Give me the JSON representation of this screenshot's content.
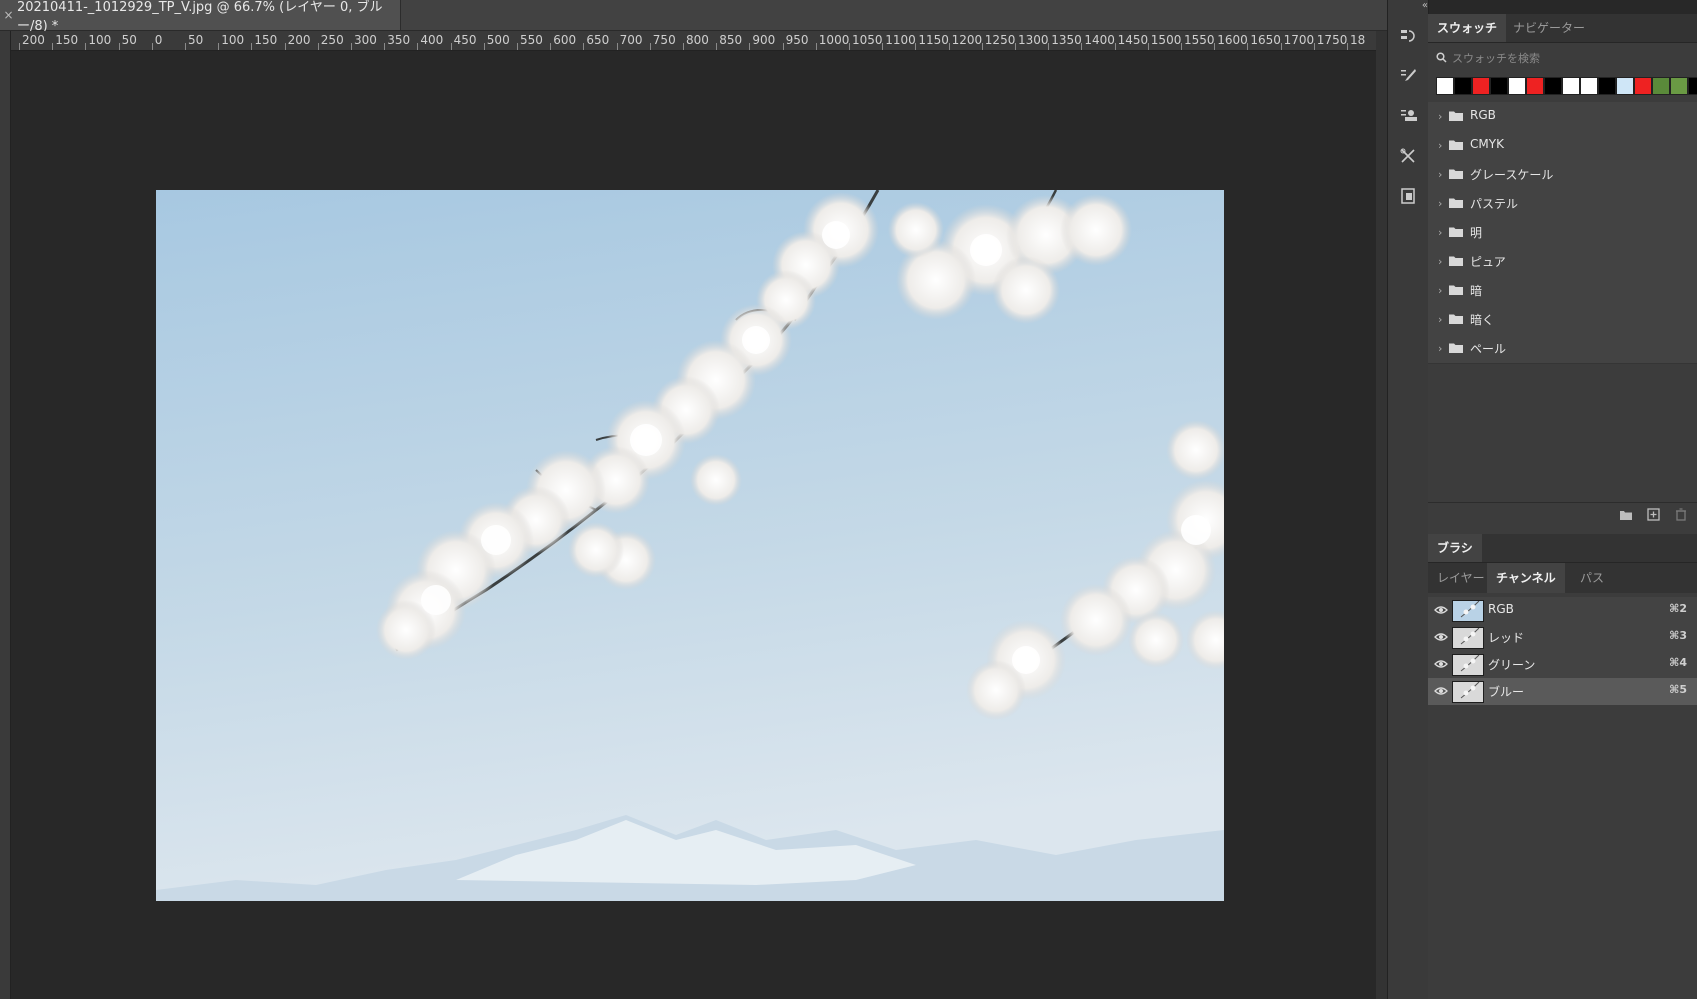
{
  "document": {
    "tab_title": "20210411-_1012929_TP_V.jpg @ 66.7% (レイヤー 0, ブルー/8) *",
    "close_glyph": "×"
  },
  "ruler": {
    "labels": [
      "200",
      "150",
      "100",
      "50",
      "0",
      "50",
      "100",
      "150",
      "200",
      "250",
      "300",
      "350",
      "400",
      "450",
      "500",
      "550",
      "600",
      "650",
      "700",
      "750",
      "800",
      "850",
      "900",
      "950",
      "1000",
      "1050",
      "1100",
      "1150",
      "1200",
      "1250",
      "1300",
      "1350",
      "1400",
      "1450",
      "1500",
      "1550",
      "1600",
      "1650",
      "1700",
      "1750",
      "18"
    ]
  },
  "toolstrip": {
    "collapse_glyph": "«",
    "icons": [
      "history-icon",
      "brush-settings-icon",
      "clone-source-icon",
      "tool-presets-icon",
      "properties-icon"
    ]
  },
  "swatches_panel": {
    "tabs": [
      {
        "label": "スウォッチ",
        "active": true
      },
      {
        "label": "ナビゲーター",
        "active": false
      }
    ],
    "search_placeholder": "スウォッチを検索",
    "recent_colors": [
      "#ffffff",
      "#000000",
      "#ee2222",
      "#000000",
      "#ffffff",
      "#ee2222",
      "#000000",
      "#ffffff",
      "#ffffff",
      "#000000",
      "#cfe6f7",
      "#ee2222",
      "#5a8a3a",
      "#6a9a44",
      "#000000"
    ],
    "groups": [
      "RGB",
      "CMYK",
      "グレースケール",
      "パステル",
      "明",
      "ピュア",
      "暗",
      "暗く",
      "ペール"
    ]
  },
  "brush_panel": {
    "label": "ブラシ"
  },
  "channels_panel": {
    "tabs": [
      {
        "label": "レイヤー",
        "active": false
      },
      {
        "label": "チャンネル",
        "active": true
      },
      {
        "label": "パス",
        "active": false
      }
    ],
    "channels": [
      {
        "name": "RGB",
        "shortcut": "⌘2",
        "selected": false
      },
      {
        "name": "レッド",
        "shortcut": "⌘3",
        "selected": false
      },
      {
        "name": "グリーン",
        "shortcut": "⌘4",
        "selected": false
      },
      {
        "name": "ブルー",
        "shortcut": "⌘5",
        "selected": true
      }
    ]
  },
  "colors": {
    "sky_top": "#a9c9e2",
    "sky_bottom": "#dbe6ee",
    "blossom": "#f3f1ef",
    "branch": "#3a3f40"
  }
}
